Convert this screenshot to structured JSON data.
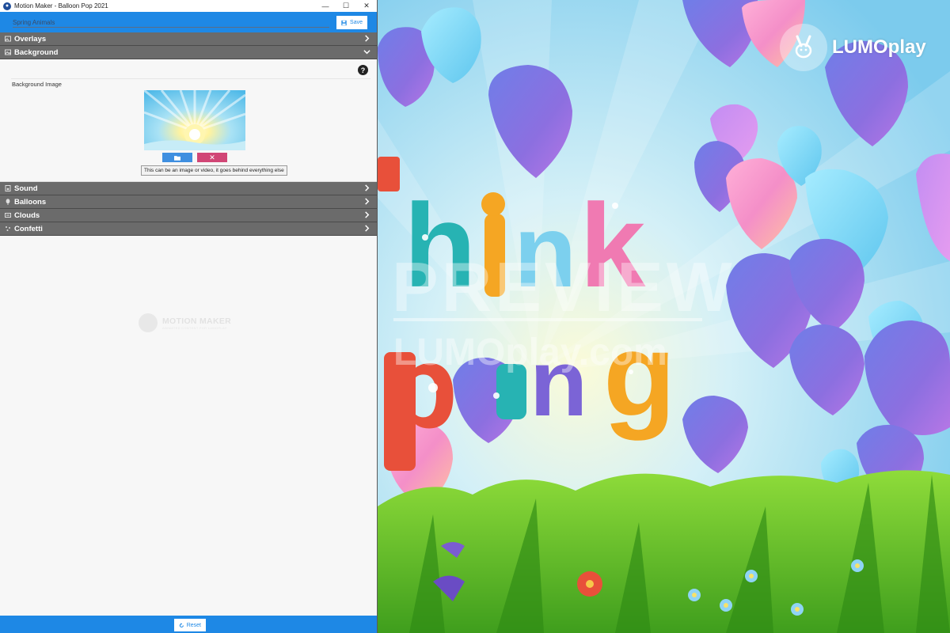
{
  "window": {
    "title": "Motion Maker - Balloon Pop 2021",
    "controls": {
      "minimize": "—",
      "maximize": "☐",
      "close": "✕"
    }
  },
  "toolbar": {
    "name_placeholder": "Spring Animals",
    "save_label": "Save"
  },
  "sections": {
    "overlays": "Overlays",
    "background": "Background",
    "sound": "Sound",
    "balloons": "Balloons",
    "clouds": "Clouds",
    "confetti": "Confetti"
  },
  "background_panel": {
    "label": "Background Image",
    "help": "?",
    "clear_glyph": "✕",
    "tooltip": "This can be an image or video, it goes behind everything else"
  },
  "watermark": {
    "title": "MOTION MAKER",
    "subtitle": "ANIMATED CONTENT FOR LUMOPLAY"
  },
  "footer": {
    "reset_label": "Reset"
  },
  "preview": {
    "logo_text": "LUMOplay",
    "watermark_main": "PREVIEW",
    "watermark_site": "LUMOplay.com"
  },
  "colors": {
    "accent": "#1e88e5",
    "header_gray": "#6b6b6b",
    "clear_pink": "#d14676"
  }
}
